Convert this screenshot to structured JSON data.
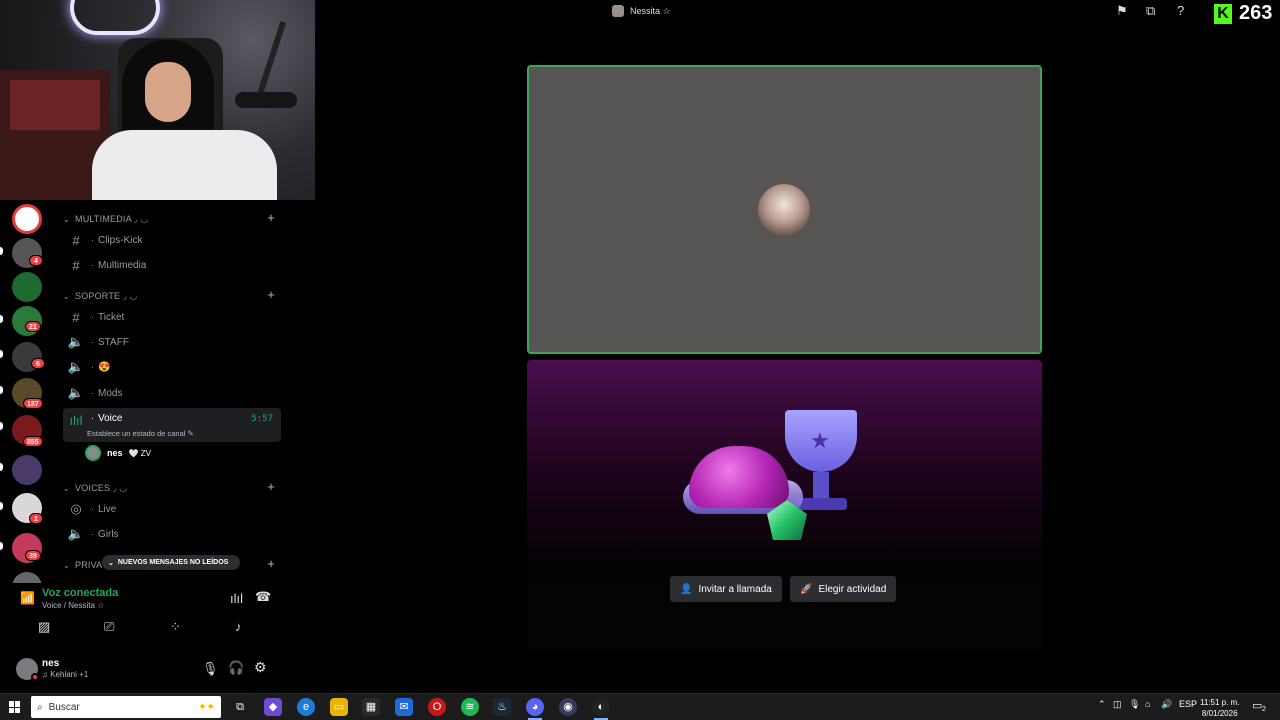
{
  "window": {
    "title": "Nessita ☆"
  },
  "kick": {
    "count": "263",
    "logo_letter": "K"
  },
  "server_badges": [
    "4",
    "21",
    "6",
    "187",
    "855",
    "1",
    "39"
  ],
  "channels": {
    "categories": [
      {
        "label": "MULTIMEDIA ◞ ◡"
      },
      {
        "label": "SOPORTE ◞ ◡"
      },
      {
        "label": "VOICES ◞ ◡"
      },
      {
        "label": "PRIVA"
      }
    ],
    "items": [
      {
        "name": "Clips-Kick",
        "type": "text"
      },
      {
        "name": "Multimedia",
        "type": "text"
      },
      {
        "name": "Ticket",
        "type": "text"
      },
      {
        "name": "STAFF",
        "type": "voice"
      },
      {
        "name": "😍",
        "type": "voice"
      },
      {
        "name": "Mods",
        "type": "voice"
      },
      {
        "name": "Voice",
        "type": "voice-active",
        "timer": "5:57",
        "status": "Establece un estado de canal ✎"
      },
      {
        "name": "Live",
        "type": "stage"
      },
      {
        "name": "Girls",
        "type": "voice"
      }
    ],
    "member": {
      "name": "nes",
      "tag": "🤍 ZV"
    },
    "unread_pill": "NUEVOS MENSAJES NO LEÍDOS"
  },
  "voice_panel": {
    "title": "Voz conectada",
    "subtitle": "Voice / Nessita ☆"
  },
  "user_panel": {
    "name": "nes",
    "activity": "♫ Kehlani +1"
  },
  "stage": {
    "invite_label": "Invitar a llamada",
    "activity_label": "Elegir actividad"
  },
  "taskbar": {
    "search_placeholder": "Buscar",
    "language": "ESP",
    "time": "11:51 p. m.",
    "date": "8/01/2026",
    "notifications": "2"
  },
  "colors": {
    "speaking_border": "#3fa55c",
    "voice_connected": "#23a55a",
    "kick_green": "#53fc18",
    "badge_red": "#f23f43"
  }
}
